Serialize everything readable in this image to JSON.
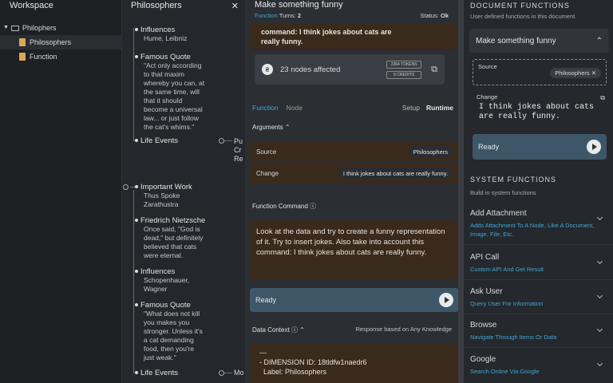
{
  "workspace": {
    "title": "Workspace",
    "items": [
      {
        "label": "Philophers"
      },
      {
        "label": "Philosophers"
      },
      {
        "label": "Function"
      }
    ]
  },
  "tree": {
    "title": "Philosophers",
    "nodes": [
      {
        "title": "Influences",
        "body": "Hume, Leibniz"
      },
      {
        "title": "Famous Quote",
        "body": "\"Act only according\nto that maxim\nwhereby you can, at\nthe same time, will\nthat it should\nbecome a universal\nlaw... or just follow\nthe cat's whims.\""
      },
      {
        "title": "Life Events",
        "body": ""
      },
      {
        "title": "Important Work",
        "body": "Thus Spoke\nZarathustra"
      },
      {
        "title": "Friedrich Nietzsche",
        "body": "Once said, \"God is\ndead,\" but definitely\nbelieved that cats\nwere eternal."
      },
      {
        "title": "Influences",
        "body": "Schopenhauer,\nWagner"
      },
      {
        "title": "Famous Quote",
        "body": "\"What does not kill\nyou makes you\nstronger. Unless it's\na cat demanding\nfood, then you're\njust weak.\""
      },
      {
        "title": "Life Events",
        "body": ""
      }
    ],
    "overflow": [
      "Pu",
      "Cr",
      "Re",
      "Mo"
    ]
  },
  "function": {
    "title": "Make something funny",
    "type": "Function",
    "turns_label": "Turns:",
    "turns": "2",
    "status_label": "Status:",
    "status": "Ok",
    "preview": "command: I think jokes about cats are\nreally funny.",
    "nodes_affected": "23 nodes affected",
    "tokens": "2364 TOKENS",
    "credits": "6 CREDITS",
    "tabs": {
      "function": "Function",
      "node": "Node",
      "setup": "Setup",
      "runtime": "Runtime"
    },
    "arguments_label": "Arguments",
    "source_label": "Source",
    "source_value": "Philosophers",
    "change_label": "Change",
    "change_value": "I think jokes about cats are really funny.",
    "command_label": "Function Command",
    "command_text": "Look at the data and try to create a funny representation of it. Try to insert jokes. Also take into account this command: I think jokes about cats are really funny.",
    "ready": "Ready",
    "context_label": "Data Context",
    "context_right": "Response based on Any Knowledge",
    "context_text": "---\n- DIMENSION ID: 18tldfw1naedr6\n  Label: Philosophers"
  },
  "doc": {
    "title": "DOCUMENT FUNCTIONS",
    "subtitle": "User defined functions in this document",
    "fn_title": "Make something funny",
    "source_label": "Source",
    "source_value": "Philosophers",
    "change_label": "Change",
    "change_value": "I think jokes about cats are really funny.",
    "ready": "Ready",
    "sys_title": "SYSTEM FUNCTIONS",
    "sys_subtitle": "Build in system functions",
    "sys": [
      {
        "name": "Add Attachment",
        "desc": "Adds Attachment To A Node, Like A Document, Image, File, Etc."
      },
      {
        "name": "API Call",
        "desc": "Custom API And Get Result"
      },
      {
        "name": "Ask User",
        "desc": "Query User For Information"
      },
      {
        "name": "Browse",
        "desc": "Navigate Through Items Or Data"
      },
      {
        "name": "Google",
        "desc": "Search Online Via Google"
      }
    ]
  }
}
